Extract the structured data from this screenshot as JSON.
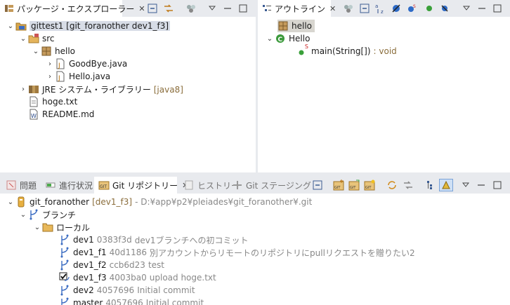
{
  "package_explorer": {
    "tab_label": "パッケージ・エクスプローラー",
    "tree": {
      "project": {
        "name": "gittest1",
        "decoration": "[git_foranother dev1_f3]"
      },
      "src": "src",
      "package": "hello",
      "files": [
        "GoodBye.java",
        "Hello.java"
      ],
      "jre": {
        "name": "JRE システム・ライブラリー",
        "decoration": "[java8]"
      },
      "hoge": "hoge.txt",
      "readme": "README.md"
    }
  },
  "outline": {
    "tab_label": "アウトライン",
    "items": {
      "package": "hello",
      "class": "Hello",
      "method": "main(String[])",
      "method_return": ": void",
      "method_badge": "S"
    }
  },
  "bottom": {
    "tabs": [
      "問題",
      "進行状況",
      "Git リポジトリー",
      "ヒストリー",
      "Git ステージング"
    ],
    "repo": {
      "name": "git_foranother",
      "branch": "[dev1_f3]",
      "path": "- D:¥app¥p2¥pleiades¥git_foranother¥.git"
    },
    "branches_label": "ブランチ",
    "local_label": "ローカル",
    "branches": [
      {
        "name": "dev1",
        "sha": "0383f3d",
        "msg": "dev1ブランチへの初コミット"
      },
      {
        "name": "dev1_f1",
        "sha": "40d1186",
        "msg": "別アカウントからリモートのリポジトリにpullリクエストを贈りたい2"
      },
      {
        "name": "dev1_f2",
        "sha": "ccb6d23",
        "msg": "test"
      },
      {
        "name": "dev1_f3",
        "sha": "4003ba0",
        "msg": "upload hoge.txt"
      },
      {
        "name": "dev2",
        "sha": "4057696",
        "msg": "Initial commit"
      },
      {
        "name": "master",
        "sha": "4057696",
        "msg": "Initial commit"
      }
    ]
  }
}
